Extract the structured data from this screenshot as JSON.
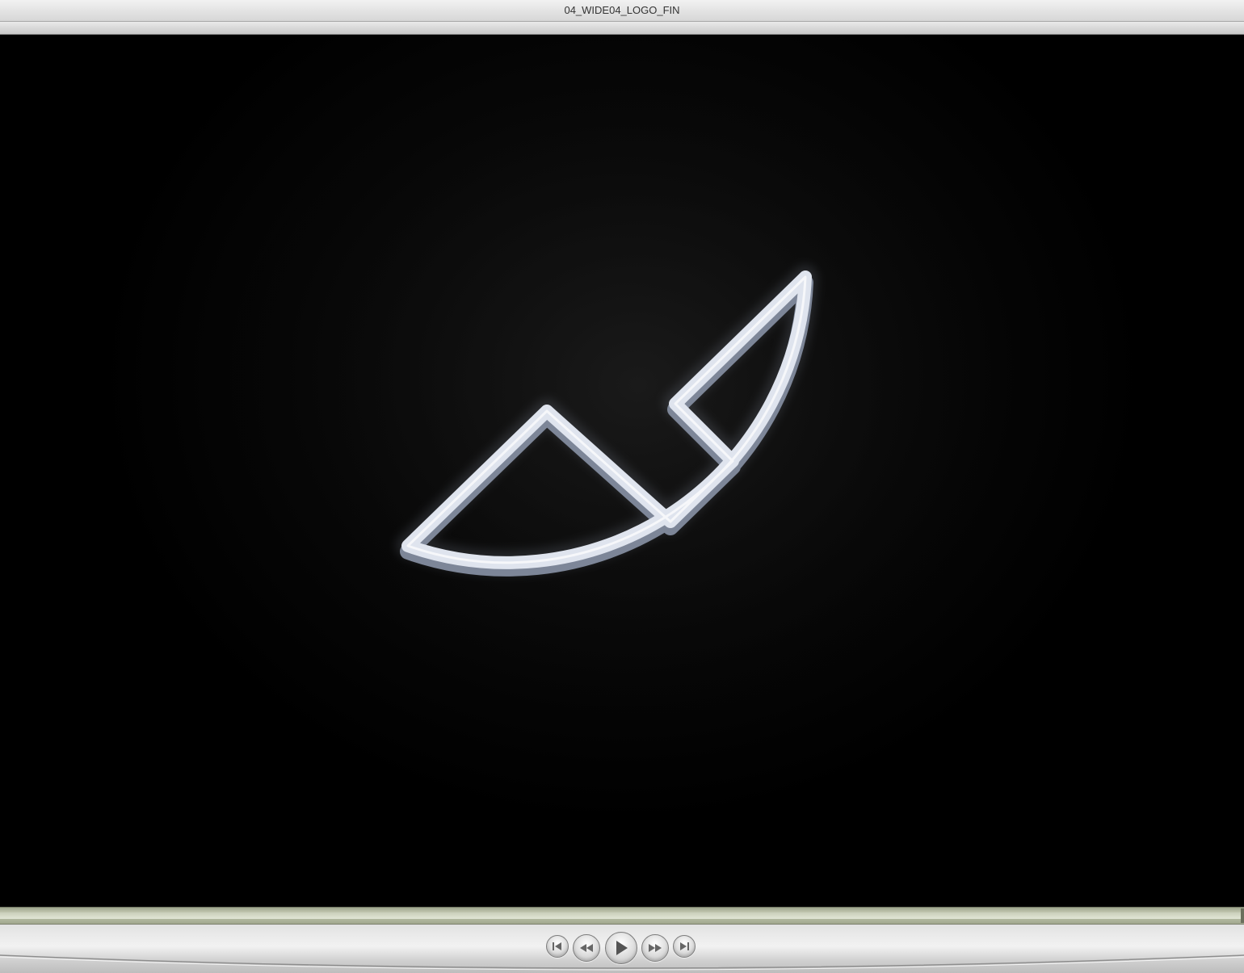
{
  "window": {
    "title": "04_WIDE04_LOGO_FIN"
  },
  "video": {
    "logo": "rounded-quarter-circle-outline-logo",
    "background_color": "#000000",
    "logo_color": "#dfe4ee"
  },
  "playback": {
    "progress_fraction": 1.0
  },
  "controls": {
    "icons": [
      "skip-to-start-icon",
      "rewind-icon",
      "play-icon",
      "fast-forward-icon",
      "skip-to-end-icon"
    ]
  }
}
